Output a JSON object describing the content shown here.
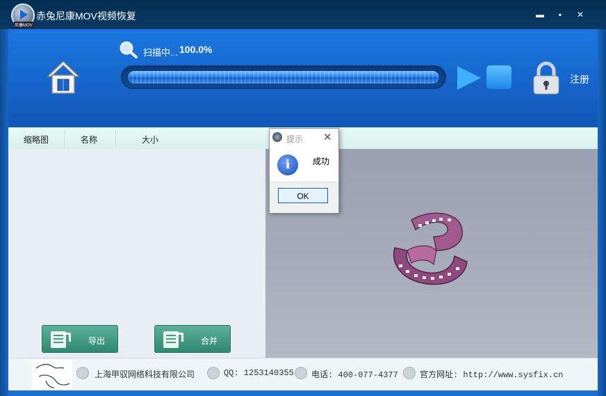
{
  "window": {
    "title": "赤兔尼康MOV视频恢复",
    "logo_tag": "尼康MOV",
    "minimize_glyph": "▬",
    "maximize_glyph": "▪",
    "close_glyph": "✕"
  },
  "header": {
    "scan_label": "扫描中...",
    "scan_percent": "100.0%",
    "progress_fraction": 1.0,
    "register_label": "注册"
  },
  "columns": [
    "缩略图",
    "名称",
    "大小"
  ],
  "buttons": {
    "export_label": "导出",
    "merge_label": "合并"
  },
  "footer": {
    "company": "上海甲驭网络科技有限公司",
    "qq": "QQ: 1253140355",
    "phone": "电话: 400-077-4377",
    "website": "官方网址: http://www.sysfix.cn"
  },
  "dialog": {
    "title": "提示",
    "message": "成功",
    "ok_label": "OK",
    "close_glyph": "✕",
    "info_glyph": "i"
  },
  "colors": {
    "header_blue": "#1b78e0",
    "title_bar": "#062e52",
    "button_green": "#2d8a70"
  }
}
